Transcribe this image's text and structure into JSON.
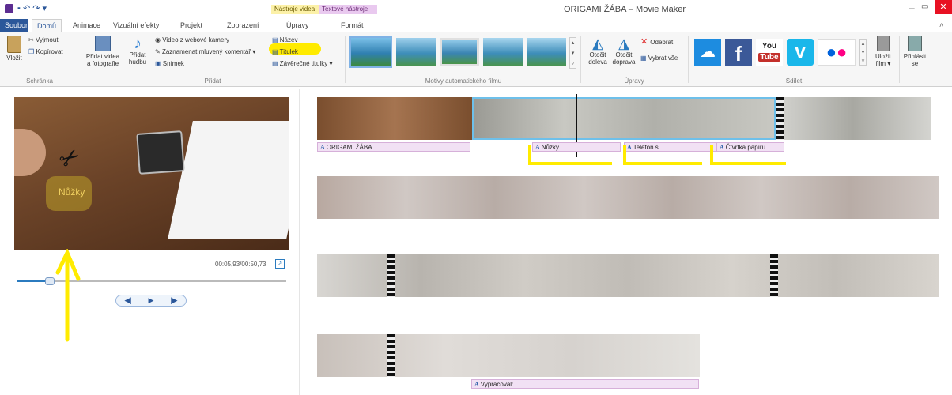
{
  "window": {
    "title": "ORIGAMI ŽÁBA – Movie Maker"
  },
  "contextual": {
    "video_tools": "Nástroje videa",
    "text_tools": "Textové nástroje"
  },
  "tabs": [
    "Soubor",
    "Domů",
    "Animace",
    "Vizuální efekty",
    "Projekt",
    "Zobrazení",
    "Úpravy",
    "Formát"
  ],
  "ribbon": {
    "clipboard": {
      "paste": "Vložit",
      "cut": "Vyjmout",
      "copy": "Kopírovat",
      "group": "Schránka"
    },
    "add": {
      "add_videos_line1": "Přidat videa",
      "add_videos_line2": "a fotografie",
      "add_music_line1": "Přidat",
      "add_music_line2": "hudbu",
      "webcam": "Video z webové kamery",
      "narration": "Zaznamenat mluvený komentář",
      "snapshot": "Snímek",
      "title": "Název",
      "caption": "Titulek",
      "credits": "Závěrečné titulky",
      "group": "Přidat"
    },
    "themes": {
      "group": "Motivy automatického filmu"
    },
    "edit": {
      "rotate_left_1": "Otočit",
      "rotate_left_2": "doleva",
      "rotate_right_1": "Otočit",
      "rotate_right_2": "doprava",
      "remove": "Odebrat",
      "select_all": "Vybrat vše",
      "group": "Úpravy"
    },
    "share": {
      "save_movie_1": "Uložit",
      "save_movie_2": "film",
      "sign_in_1": "Přihlásit",
      "sign_in_2": "se",
      "group": "Sdílet"
    }
  },
  "preview": {
    "caption": "Nůžky",
    "time": "00:05,93/00:50,73",
    "progress": 0.12
  },
  "timeline": {
    "captions_row1": [
      "ORIGAMI ŽÁBA",
      "Nůžky",
      "Telefon s",
      "Čtvrtka papíru"
    ],
    "captions_row4": [
      "Vypracoval:"
    ]
  },
  "colors": {
    "accent": "#2b579a",
    "highlight": "#ffeb00",
    "caption_bg": "#f1e1f4",
    "ctx_video": "#fcf1a8",
    "ctx_text": "#e9c9ef"
  }
}
